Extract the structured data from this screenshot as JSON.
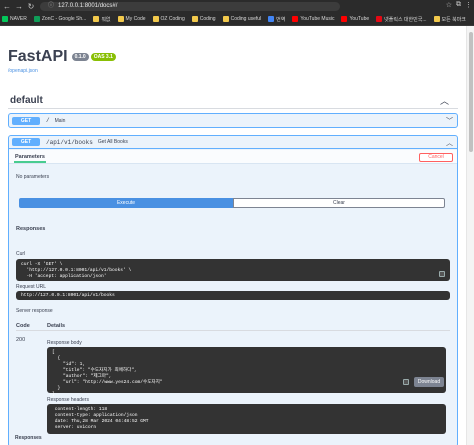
{
  "browser": {
    "url": "127.0.0.1:8001/docs#/",
    "bookmarks": [
      {
        "label": "NAVER",
        "color": "#03c75a"
      },
      {
        "label": "ZonC - Google Sh...",
        "color": "#0f9d58"
      },
      {
        "label": "뭐없",
        "color": "#f2c94c"
      },
      {
        "label": "My Code",
        "color": "#f2c94c"
      },
      {
        "label": "OZ Coding",
        "color": "#f2c94c"
      },
      {
        "label": "Coding",
        "color": "#f2c94c"
      },
      {
        "label": "Coding useful",
        "color": "#f2c94c"
      },
      {
        "label": "번역",
        "color": "#4285f4"
      },
      {
        "label": "YouTube Music",
        "color": "#ff0000"
      },
      {
        "label": "YouTube",
        "color": "#ff0000"
      },
      {
        "label": "넷플릭스 대한민국...",
        "color": "#e50914"
      },
      {
        "label": "모든 북마크",
        "color": "#f2c94c"
      }
    ]
  },
  "api": {
    "title": "FastAPI",
    "version": "0.1.0",
    "oas": "OAS 3.1",
    "openapi_link": "/openapi.json"
  },
  "section": {
    "name": "default"
  },
  "operations": [
    {
      "method": "GET",
      "path": "/",
      "summary": "Main"
    },
    {
      "method": "GET",
      "path": "/api/v1/books",
      "summary": "Get All Books"
    }
  ],
  "try_out": {
    "parameters_tab": "Parameters",
    "cancel_label": "Cancel",
    "no_parameters": "No parameters",
    "execute_label": "Execute",
    "clear_label": "Clear"
  },
  "responses": {
    "title": "Responses",
    "curl_label": "Curl",
    "curl_lines": [
      "curl -X 'GET' \\",
      "  'http://127.0.0.1:8001/api/v1/books' \\",
      "  -H 'accept: application/json'"
    ],
    "request_url_label": "Request URL",
    "request_url": "http://127.0.0.1:8001/api/v1/books",
    "server_response_label": "Server response",
    "code_header": "Code",
    "details_header": "Details",
    "code": "200",
    "body_label": "Response body",
    "body_lines": [
      "[",
      "  {",
      "    \"id\": 1,",
      "    \"title\": \"수도자지가 최애하다\",",
      "    \"author\": \"제그마\",",
      "    \"url\": \"http://www.yes24.com/수도자지\"",
      "  }",
      "]"
    ],
    "download_label": "Download",
    "headers_label": "Response headers",
    "header_lines": [
      " content-length: 118 ",
      " content-type: application/json ",
      " date: Thu,28 Mar 2024 04:48:52 GMT ",
      " server: uvicorn "
    ],
    "footer_label": "Responses"
  }
}
